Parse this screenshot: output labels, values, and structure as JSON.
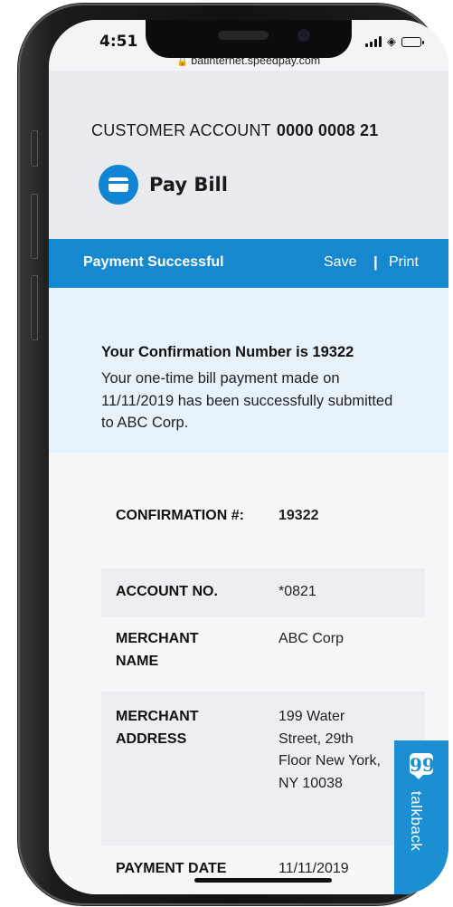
{
  "status_bar": {
    "time": "4:51",
    "url": "batinternet.speedpay.com"
  },
  "header": {
    "account_label": "CUSTOMER ACCOUNT",
    "account_number": "0000 0008 21",
    "page_title": "Pay Bill"
  },
  "result_bar": {
    "title": "Payment Successful",
    "save_label": "Save",
    "separator": "|",
    "print_label": "Print"
  },
  "confirmation": {
    "title": "Your Confirmation Number is 19322",
    "message": "Your one-time bill payment made on 11/11/2019 has been successfully submitted to ABC Corp."
  },
  "details": [
    {
      "label": "CONFIRMATION #:",
      "value": "19322"
    },
    {
      "label": "ACCOUNT NO.",
      "value": "*0821"
    },
    {
      "label": "MERCHANT NAME",
      "value": "ABC Corp"
    },
    {
      "label": "MERCHANT ADDRESS",
      "value": "199 Water Street, 29th Floor New York, NY 10038"
    },
    {
      "label": "PAYMENT DATE",
      "value": "11/11/2019"
    }
  ],
  "talkback": {
    "icon_glyph": "99",
    "label": "talkback"
  },
  "colors": {
    "accent": "#1588cf",
    "confirmation_bg": "#e8f2fb"
  },
  "icons": [
    "lock-icon",
    "credit-card-icon",
    "signal-icon",
    "wifi-icon",
    "battery-icon",
    "quote-bubble-icon"
  ]
}
